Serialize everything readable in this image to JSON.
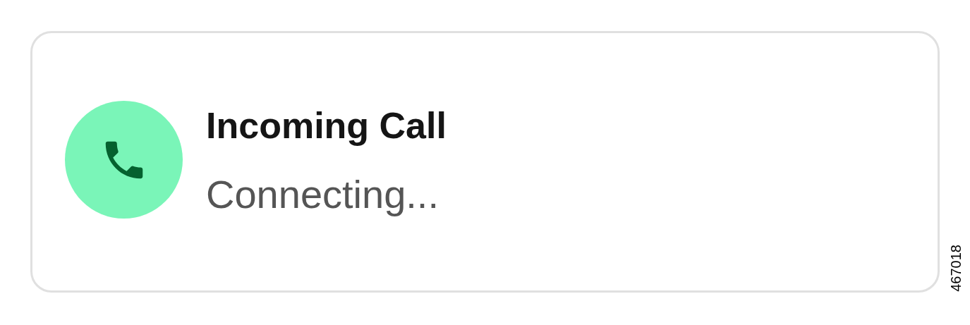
{
  "notification": {
    "title": "Incoming Call",
    "status": "Connecting..."
  },
  "figure_id": "467018"
}
